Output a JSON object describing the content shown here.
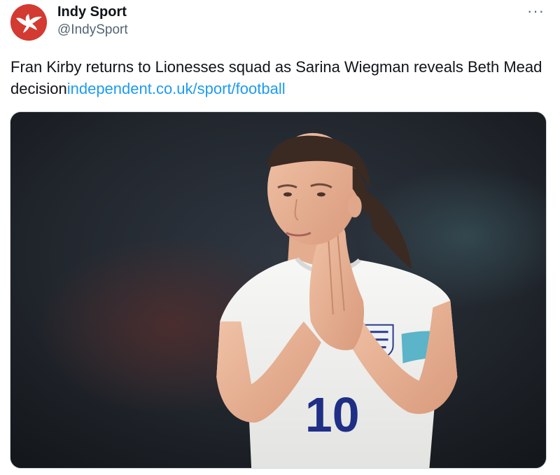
{
  "author": {
    "display_name": "Indy Sport",
    "handle": "@IndySport",
    "avatar_icon": "eagle-logo-icon",
    "avatar_color": "#d33a31"
  },
  "menu": {
    "more_label": "···",
    "icon": "more-options-icon"
  },
  "tweet": {
    "text": "Fran Kirby returns to Lionesses squad as Sarina Wiegman reveals Beth Mead decision",
    "link_text": "independent.co.uk/sport/football",
    "link_color": "#1d9bf0"
  },
  "media": {
    "shirt_number": "10",
    "armband_color": "#5bb4c8"
  }
}
